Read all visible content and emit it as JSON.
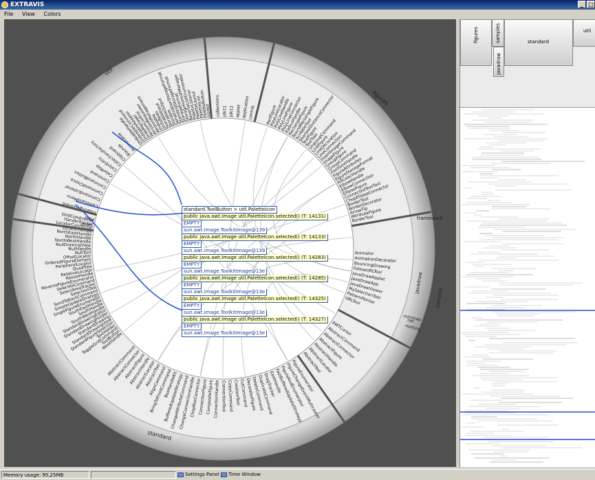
{
  "window": {
    "title": "EXTRAVIS",
    "min": "_",
    "max": "□"
  },
  "menu": [
    "File",
    "View",
    "Colors"
  ],
  "circle": {
    "segments": [
      "util",
      "figures",
      "standard",
      "framework",
      "javadraw",
      "samples",
      "nothing",
      "minimap",
      "net"
    ],
    "labels_util_upper": [
      "UndoableHandle",
      "UndoableCommand",
      "UndoableAdapter",
      "UndoManager",
      "VersionControl",
      "VersionRequester",
      "VersionManagement",
      "Undoable",
      "UndoRedo",
      "StorableInput",
      "StorableOutput",
      "Storable",
      "SerializationStorageFormat",
      "StandardStorageFormat",
      "StorageFormat",
      "StorageFormatManager",
      "ReverseListEnumerator",
      "PaletteListener",
      "PaletteLayout",
      "PaletteIcon",
      "PaletteButton",
      "Iconkit"
    ],
    "labels_util_left": [
      "Geom",
      "Filler",
      "FloatingTextField",
      "CommandMenu",
      "CommandListener",
      "CommandChoice",
      "CommandButton",
      "Command",
      "ColorMap",
      "ColorEntry",
      "CollectionsFactory",
      "Clipboard",
      "Bounds",
      "Animatable"
    ],
    "labels_standard_left": [
      "WestHandle",
      "ToolButton",
      "ToggleGridCommand",
      "TextHolder",
      "StandardFigureSelection",
      "StandardDrawingView",
      "StandardDrawing",
      "StandardDrawingHolder",
      "StandardDrawingEditor",
      "SouthWestHandle",
      "SouthHandle",
      "SouthEastHandle",
      "SingleFigureEnumerator",
      "SimpleUpdateStrategy",
      "SendToBackCommand",
      "SelectionTool",
      "SelectAreaTracker",
      "SelectAllCommand",
      "ReverseFigureEnumerator",
      "ResizeHandle",
      "RelativeLocator",
      "QuadTree",
      "PeripheralLocator",
      "OrderedFigureElement",
      "OffsetLocator",
      "NullTool",
      "NullHandle",
      "NullDrawingView",
      "NorthWestHandle",
      "NorthHandle",
      "NorthEastHandle",
      "LocatorHandle",
      "LocatorConnector",
      "HandleTracker",
      "GridConstrainer"
    ],
    "labels_standard_bottom": [
      "FigureEnumerator",
      "FigureChangeEventMulticaster",
      "FigureAndEnumerator",
      "FastBufferedUpdateStrategy",
      "EastHandle",
      "DragTracker",
      "DuplicateCommand",
      "DeleteCommand",
      "DecoratorFigure",
      "CutCommand",
      "CreationTool",
      "CopyCommand",
      "ConnectionTool",
      "ConnectionHandle",
      "CompositeFigure",
      "ConnectionFigure",
      "ChopBoxConnector",
      "ChangeConnectionHandle",
      "ChangeAttributeCommand",
      "BufferedUpdateStrategy",
      "BoxHandleKit",
      "BringToFrontCommand",
      "AlignCommand",
      "AbstractTool",
      "AbstractLocator",
      "AbstractHandle",
      "AbstractFigure",
      "AbstractConnector",
      "AbstractCommand"
    ],
    "labels_figures": [
      "PertFigure",
      "PolyLineLocator",
      "PolyLineHandle",
      "PolyLineFigure",
      "PolyLineConnector",
      "RadiusHandle",
      "RectangleFigure",
      "RoundRectangleFigure",
      "ScribbleTool",
      "ShortestDistanceConnector",
      "TextFigure",
      "TextTool",
      "UngroupCommand",
      "LineFigure",
      "LineDecoration",
      "LineConnection",
      "InsertImageCommand",
      "ImageFigure",
      "GroupFigure",
      "GroupCommand",
      "FontSizeHandle",
      "FigureAttributes",
      "FigureStorageFormat",
      "FillColorHandle",
      "ElbowHandle",
      "ElbowConnection",
      "EllipseFigure",
      "ConnectedTextTool",
      "ChopEllipseConnector",
      "BorderTool",
      "BorderDecorator",
      "ArrowTip",
      "AttributeFigure",
      "BorderTool"
    ],
    "labels_framework": [
      "framework"
    ],
    "labels_javadraw": [
      "Animator",
      "AnimationDecorator",
      "BouncingDrawing",
      "FollowURLTool",
      "JavaDrawApplet",
      "JavaDrawApp",
      "JavaDrawViewer",
      "MySelectionTool",
      "PatternPainter",
      "URLTool"
    ],
    "labels_top_small": [
      "collections",
      "jdk11",
      "jdk12",
      "applet",
      "application",
      "contrib"
    ],
    "labels_bottom_right": [
      "AWTCursor",
      "AbstractCommand",
      "AbstractConnector",
      "AbstractFigure",
      "AbstractHandle",
      "AbstractLocator",
      "AbstractTool"
    ]
  },
  "tooltip": {
    "header": "standard.ToolButton  >  util.PaletteIcon",
    "rows": [
      {
        "kind": "call",
        "text": "public   java.awt.Image   util.PaletteIcon.selected()   (T:  14131)"
      },
      {
        "kind": "empty",
        "text": "EMPTY"
      },
      {
        "kind": "obj",
        "text": "sun.awt.image.ToolkitImage@139"
      },
      {
        "kind": "call",
        "text": "public   java.awt.Image   util.PaletteIcon.selected()   (T:  14133)"
      },
      {
        "kind": "empty",
        "text": "EMPTY"
      },
      {
        "kind": "obj",
        "text": "sun.awt.image.ToolkitImage@139"
      },
      {
        "kind": "call",
        "text": "public   java.awt.Image   util.PaletteIcon.selected()   (T:  14283)"
      },
      {
        "kind": "empty",
        "text": "EMPTY"
      },
      {
        "kind": "obj",
        "text": "sun.awt.image.ToolkitImage@13e"
      },
      {
        "kind": "call",
        "text": "public   java.awt.Image   util.PaletteIcon.selected()   (T:  14285)"
      },
      {
        "kind": "empty",
        "text": "EMPTY"
      },
      {
        "kind": "obj",
        "text": "sun.awt.image.ToolkitImage@13e"
      },
      {
        "kind": "call",
        "text": "public   java.awt.Image   util.PaletteIcon.selected()   (T:  14325)"
      },
      {
        "kind": "empty",
        "text": "EMPTY"
      },
      {
        "kind": "obj",
        "text": "sun.awt.image.ToolkitImage@13e"
      },
      {
        "kind": "call",
        "text": "public   java.awt.Image   util.PaletteIcon.selected()   (T:  14327)"
      },
      {
        "kind": "empty",
        "text": "EMPTY"
      },
      {
        "kind": "obj",
        "text": "sun.awt.image.ToolkitImage@13e"
      }
    ]
  },
  "minimap": {
    "labels": [
      "figures",
      "samples",
      "javadraw",
      "standard",
      "util"
    ]
  },
  "status": {
    "memory": "Memory usage: 95,25MB",
    "settings": "Settings Panel",
    "time": "Time Window"
  },
  "colors": {
    "titlebar": "#0a246a",
    "bundle_highlight": "#1f4fd0",
    "tooltip_call_bg": "#ffffc8",
    "tooltip_border": "#2f55a8",
    "viz_bg": "#505050"
  }
}
